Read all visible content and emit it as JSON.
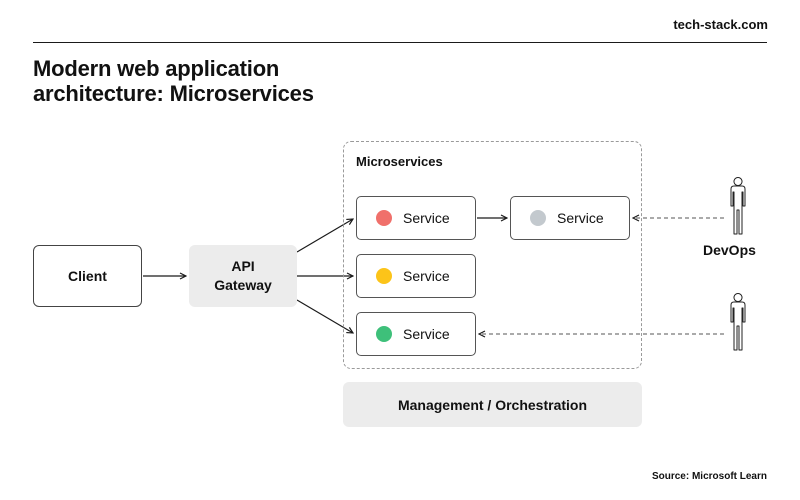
{
  "header": {
    "brand": "tech-stack.com"
  },
  "title": {
    "line1": "Modern web application",
    "line2": "architecture: Microservices"
  },
  "nodes": {
    "client": "Client",
    "gateway": {
      "line1": "API",
      "line2": "Gateway"
    },
    "microservices_label": "Microservices",
    "services": [
      {
        "label": "Service",
        "color": "#f0706b"
      },
      {
        "label": "Service",
        "color": "#fcc419"
      },
      {
        "label": "Service",
        "color": "#3ec07a"
      },
      {
        "label": "Service",
        "color": "#c3c9ce"
      }
    ],
    "management": "Management / Orchestration",
    "devops": "DevOps"
  },
  "colors": {
    "line": "#1a1a1a",
    "dashed": "#555555",
    "panel": "#ececec"
  },
  "icons": [
    "person-icon",
    "person-icon"
  ],
  "footer": {
    "source": "Source: Microsoft Learn"
  }
}
